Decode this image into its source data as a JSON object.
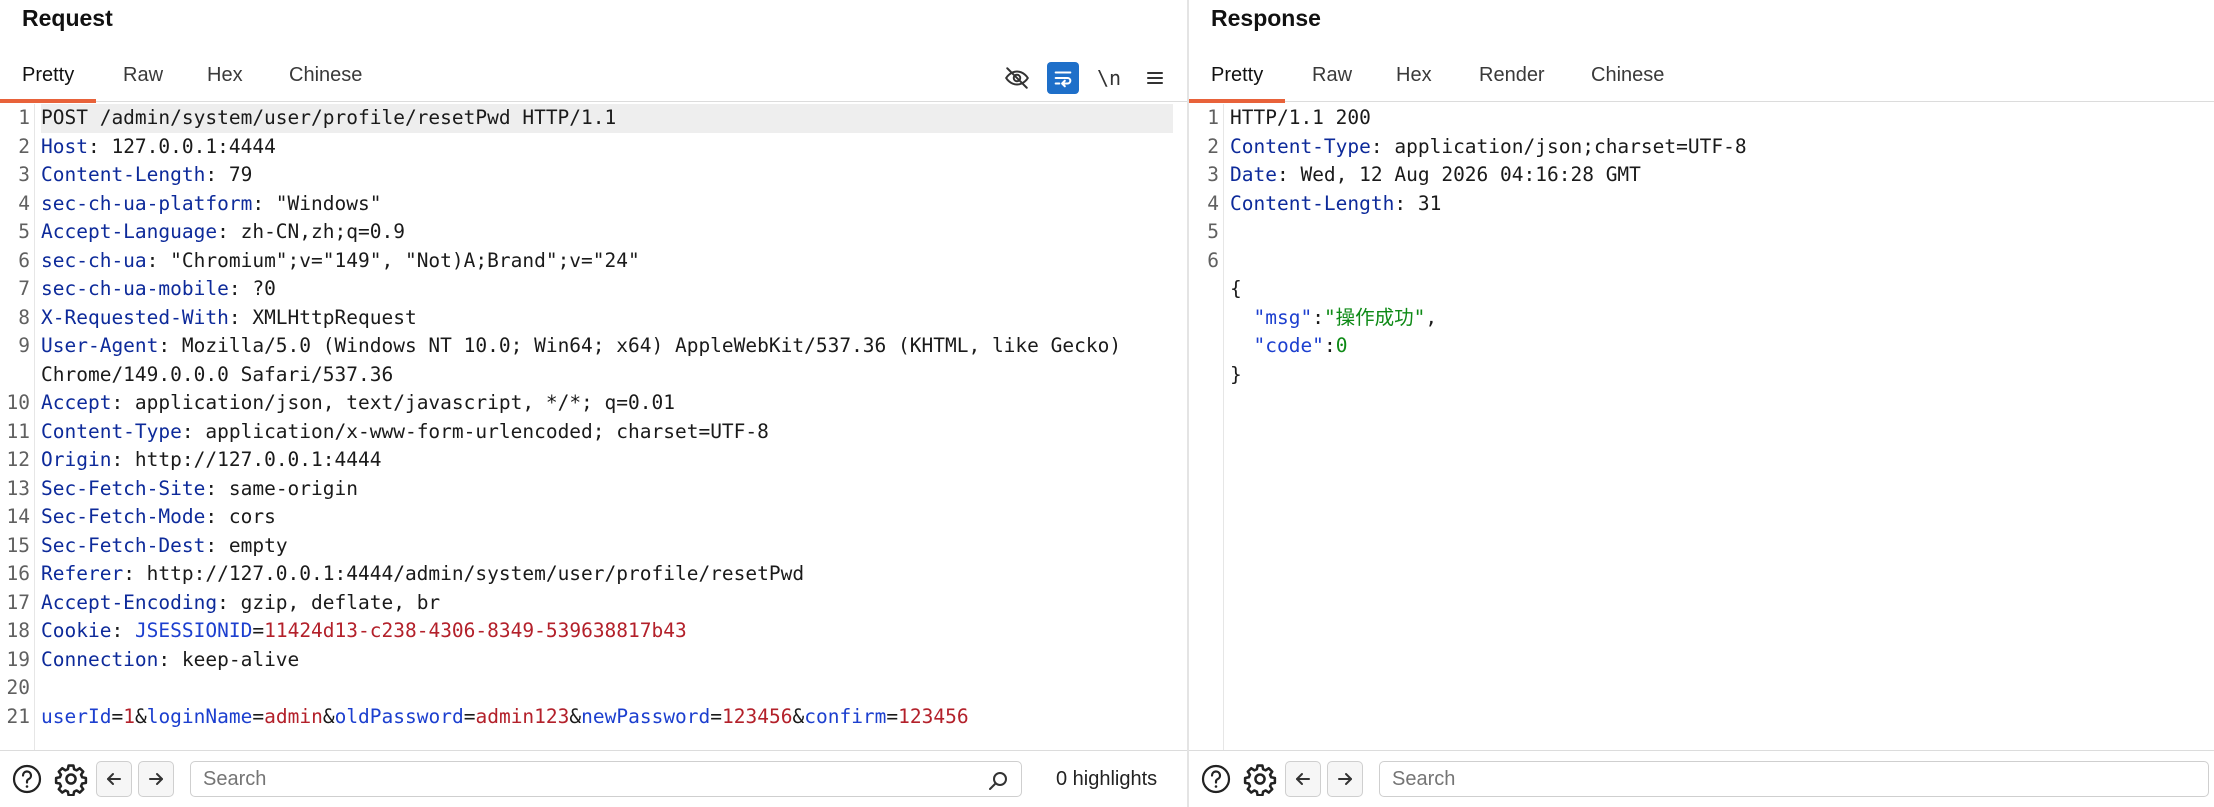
{
  "request": {
    "title": "Request",
    "tabs": [
      "Pretty",
      "Raw",
      "Hex",
      "Chinese"
    ],
    "active_tab": "Pretty",
    "toolbar": {
      "newline_label": "\\n"
    },
    "lines": [
      [
        {
          "t": "POST /admin/system/user/profile/resetPwd HTTP/1.1",
          "c": ""
        }
      ],
      [
        {
          "t": "Host",
          "c": "hk"
        },
        {
          "t": ": 127.0.0.1:4444",
          "c": ""
        }
      ],
      [
        {
          "t": "Content-Length",
          "c": "hk"
        },
        {
          "t": ": 79",
          "c": ""
        }
      ],
      [
        {
          "t": "sec-ch-ua-platform",
          "c": "hk"
        },
        {
          "t": ": \"Windows\"",
          "c": ""
        }
      ],
      [
        {
          "t": "Accept-Language",
          "c": "hk"
        },
        {
          "t": ": zh-CN,zh;q=0.9",
          "c": ""
        }
      ],
      [
        {
          "t": "sec-ch-ua",
          "c": "hk"
        },
        {
          "t": ": \"Chromium\";v=\"149\", \"Not)A;Brand\";v=\"24\"",
          "c": ""
        }
      ],
      [
        {
          "t": "sec-ch-ua-mobile",
          "c": "hk"
        },
        {
          "t": ": ?0",
          "c": ""
        }
      ],
      [
        {
          "t": "X-Requested-With",
          "c": "hk"
        },
        {
          "t": ": XMLHttpRequest",
          "c": ""
        }
      ],
      [
        {
          "t": "User-Agent",
          "c": "hk"
        },
        {
          "t": ": Mozilla/5.0 (Windows NT 10.0; Win64; x64) AppleWebKit/537.36 (KHTML, like Gecko)",
          "c": ""
        }
      ],
      [
        {
          "t": "Chrome/149.0.0.0 Safari/537.36",
          "c": ""
        }
      ],
      [
        {
          "t": "Accept",
          "c": "hk"
        },
        {
          "t": ": application/json, text/javascript, */*; q=0.01",
          "c": ""
        }
      ],
      [
        {
          "t": "Content-Type",
          "c": "hk"
        },
        {
          "t": ": application/x-www-form-urlencoded; charset=UTF-8",
          "c": ""
        }
      ],
      [
        {
          "t": "Origin",
          "c": "hk"
        },
        {
          "t": ": http://127.0.0.1:4444",
          "c": ""
        }
      ],
      [
        {
          "t": "Sec-Fetch-Site",
          "c": "hk"
        },
        {
          "t": ": same-origin",
          "c": ""
        }
      ],
      [
        {
          "t": "Sec-Fetch-Mode",
          "c": "hk"
        },
        {
          "t": ": cors",
          "c": ""
        }
      ],
      [
        {
          "t": "Sec-Fetch-Dest",
          "c": "hk"
        },
        {
          "t": ": empty",
          "c": ""
        }
      ],
      [
        {
          "t": "Referer",
          "c": "hk"
        },
        {
          "t": ": http://127.0.0.1:4444/admin/system/user/profile/resetPwd",
          "c": ""
        }
      ],
      [
        {
          "t": "Accept-Encoding",
          "c": "hk"
        },
        {
          "t": ": gzip, deflate, br",
          "c": ""
        }
      ],
      [
        {
          "t": "Cookie",
          "c": "hk"
        },
        {
          "t": ": ",
          "c": ""
        },
        {
          "t": "JSESSIONID",
          "c": "pk"
        },
        {
          "t": "=",
          "c": ""
        },
        {
          "t": "11424d13-c238-4306-8349-539638817b43",
          "c": "pv"
        }
      ],
      [
        {
          "t": "Connection",
          "c": "hk"
        },
        {
          "t": ": keep-alive",
          "c": ""
        }
      ],
      [],
      [
        {
          "t": "userId",
          "c": "pk"
        },
        {
          "t": "=",
          "c": ""
        },
        {
          "t": "1",
          "c": "pv"
        },
        {
          "t": "&",
          "c": ""
        },
        {
          "t": "loginName",
          "c": "pk"
        },
        {
          "t": "=",
          "c": ""
        },
        {
          "t": "admin",
          "c": "pv"
        },
        {
          "t": "&",
          "c": ""
        },
        {
          "t": "oldPassword",
          "c": "pk"
        },
        {
          "t": "=",
          "c": ""
        },
        {
          "t": "admin123",
          "c": "pv"
        },
        {
          "t": "&",
          "c": ""
        },
        {
          "t": "newPassword",
          "c": "pk"
        },
        {
          "t": "=",
          "c": ""
        },
        {
          "t": "123456",
          "c": "pv"
        },
        {
          "t": "&",
          "c": ""
        },
        {
          "t": "confirm",
          "c": "pk"
        },
        {
          "t": "=",
          "c": ""
        },
        {
          "t": "123456",
          "c": "pv"
        }
      ]
    ],
    "line_numbers": [
      "1",
      "2",
      "3",
      "4",
      "5",
      "6",
      "7",
      "8",
      "9",
      "",
      "10",
      "11",
      "12",
      "13",
      "14",
      "15",
      "16",
      "17",
      "18",
      "19",
      "20",
      "21"
    ],
    "search_placeholder": "Search",
    "highlights": "0 highlights"
  },
  "response": {
    "title": "Response",
    "tabs": [
      "Pretty",
      "Raw",
      "Hex",
      "Render",
      "Chinese"
    ],
    "active_tab": "Pretty",
    "lines": [
      [
        {
          "t": "HTTP/1.1 200",
          "c": ""
        }
      ],
      [
        {
          "t": "Content-Type",
          "c": "hk"
        },
        {
          "t": ": application/json;charset=UTF-8",
          "c": ""
        }
      ],
      [
        {
          "t": "Date",
          "c": "hk"
        },
        {
          "t": ": Wed, 12 Aug 2026 04:16:28 GMT",
          "c": ""
        }
      ],
      [
        {
          "t": "Content-Length",
          "c": "hk"
        },
        {
          "t": ": 31",
          "c": ""
        }
      ],
      [],
      [],
      [
        {
          "t": "{",
          "c": ""
        }
      ],
      [
        {
          "t": "  ",
          "c": ""
        },
        {
          "t": "\"msg\"",
          "c": "jk"
        },
        {
          "t": ":",
          "c": ""
        },
        {
          "t": "\"操作成功\"",
          "c": "js"
        },
        {
          "t": ",",
          "c": ""
        }
      ],
      [
        {
          "t": "  ",
          "c": ""
        },
        {
          "t": "\"code\"",
          "c": "jk"
        },
        {
          "t": ":",
          "c": ""
        },
        {
          "t": "0",
          "c": "jn"
        }
      ],
      [
        {
          "t": "}",
          "c": ""
        }
      ]
    ],
    "line_numbers": [
      "1",
      "2",
      "3",
      "4",
      "5",
      "6",
      "",
      "",
      "",
      ""
    ],
    "search_placeholder": "Search"
  },
  "icons": {
    "help": "help-icon",
    "settings": "gear-icon",
    "back": "arrow-left-icon",
    "forward": "arrow-right-icon",
    "search": "search-icon",
    "hide": "eye-off-icon",
    "wrap": "wrap-lines-icon",
    "menu": "menu-icon"
  },
  "colors": {
    "accent": "#e8623a",
    "header_key": "#0d2a9a",
    "param_key": "#1c3fcf",
    "param_value": "#b3202a",
    "json_value": "#0e8a16",
    "toggle_on": "#1e6fc9"
  }
}
